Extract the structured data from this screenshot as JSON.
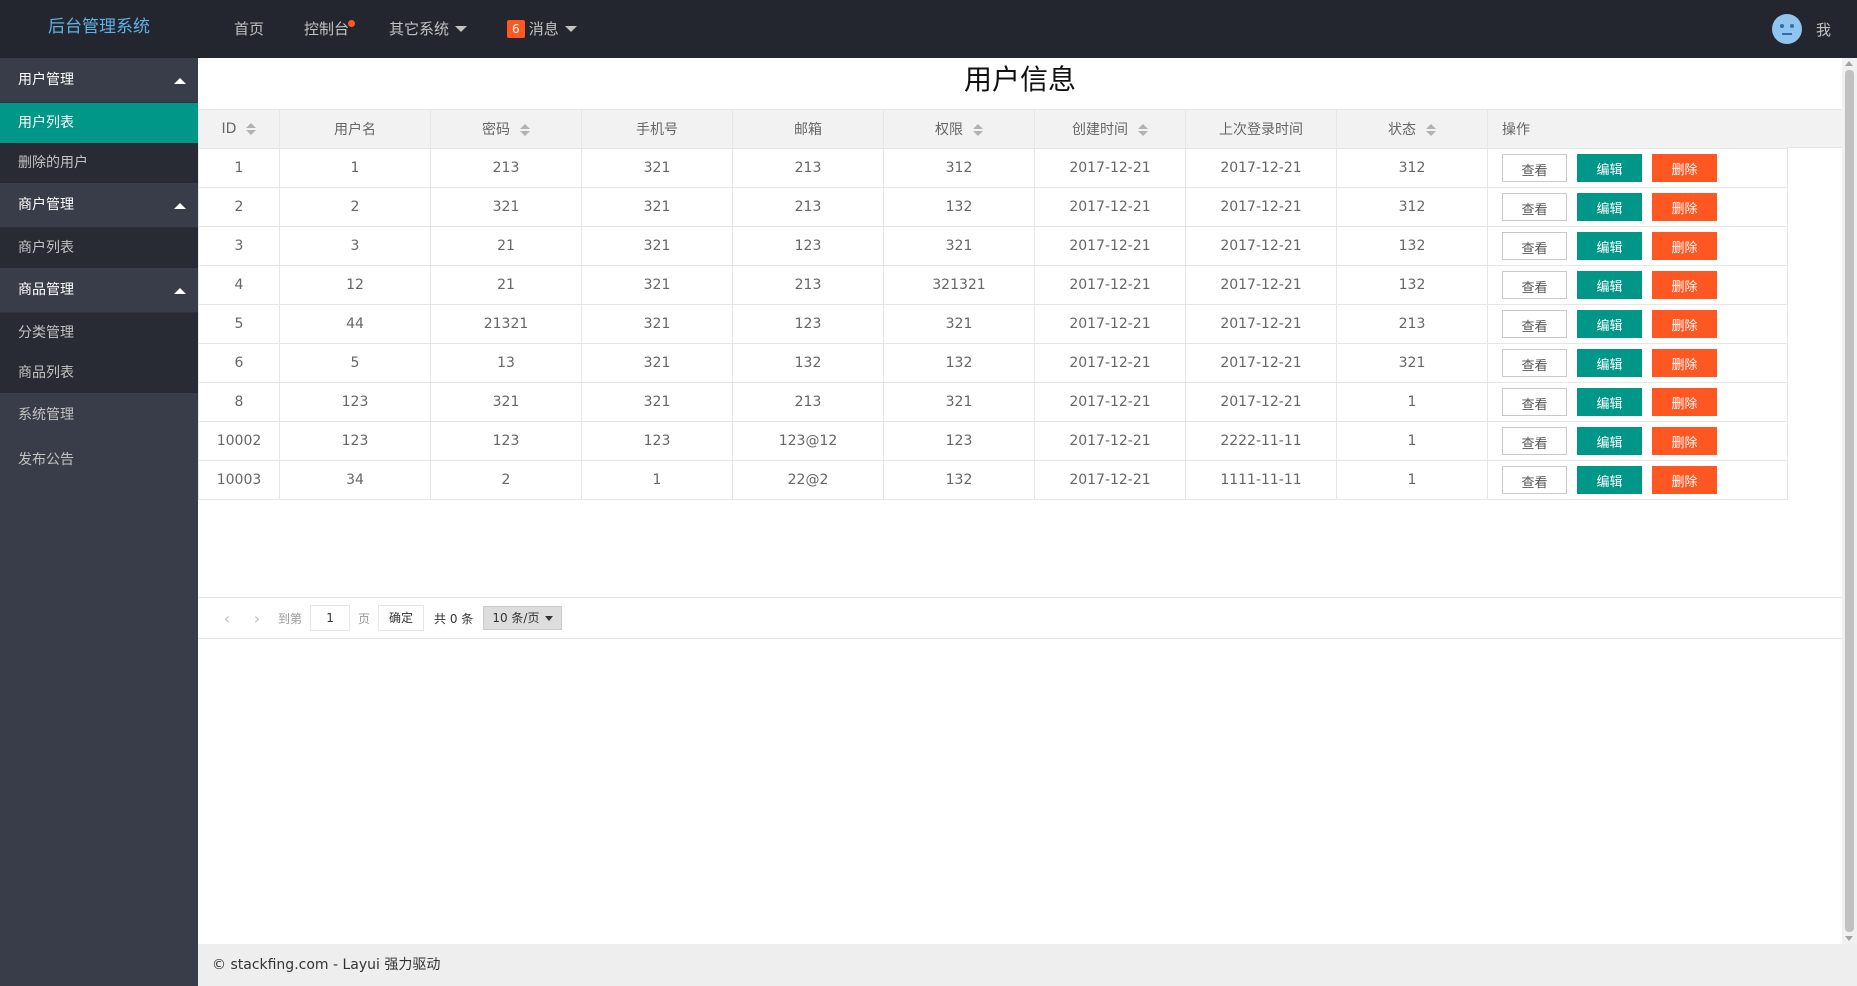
{
  "header": {
    "logo": "后台管理系统",
    "nav": [
      {
        "label": "首页"
      },
      {
        "label": "控制台"
      },
      {
        "label": "其它系统"
      },
      {
        "label": "消息",
        "badge": "6"
      }
    ],
    "user_label": "我"
  },
  "sidebar": {
    "groups": [
      {
        "label": "用户管理",
        "children": [
          "用户列表",
          "删除的用户"
        ]
      },
      {
        "label": "商户管理",
        "children": [
          "商户列表"
        ]
      },
      {
        "label": "商品管理",
        "children": [
          "分类管理",
          "商品列表"
        ]
      }
    ],
    "plain": [
      "系统管理",
      "发布公告"
    ]
  },
  "page": {
    "title": "用户信息"
  },
  "table": {
    "columns": [
      "ID",
      "用户名",
      "密码",
      "手机号",
      "邮箱",
      "权限",
      "创建时间",
      "上次登录时间",
      "状态",
      "操作"
    ],
    "rows": [
      [
        "1",
        "1",
        "213",
        "321",
        "213",
        "312",
        "2017-12-21",
        "2017-12-21",
        "312"
      ],
      [
        "2",
        "2",
        "321",
        "321",
        "213",
        "132",
        "2017-12-21",
        "2017-12-21",
        "312"
      ],
      [
        "3",
        "3",
        "21",
        "321",
        "123",
        "321",
        "2017-12-21",
        "2017-12-21",
        "132"
      ],
      [
        "4",
        "12",
        "21",
        "321",
        "213",
        "321321",
        "2017-12-21",
        "2017-12-21",
        "132"
      ],
      [
        "5",
        "44",
        "21321",
        "321",
        "123",
        "321",
        "2017-12-21",
        "2017-12-21",
        "213"
      ],
      [
        "6",
        "5",
        "13",
        "321",
        "132",
        "132",
        "2017-12-21",
        "2017-12-21",
        "321"
      ],
      [
        "8",
        "123",
        "321",
        "321",
        "213",
        "321",
        "2017-12-21",
        "2017-12-21",
        "1"
      ],
      [
        "10002",
        "123",
        "123",
        "123",
        "123@12",
        "123",
        "2017-12-21",
        "2222-11-11",
        "1"
      ],
      [
        "10003",
        "34",
        "2",
        "1",
        "22@2",
        "132",
        "2017-12-21",
        "1111-11-11",
        "1"
      ]
    ],
    "actions": {
      "view": "查看",
      "edit": "编辑",
      "delete": "删除"
    }
  },
  "pager": {
    "goto_label": "到第",
    "page_value": "1",
    "page_unit": "页",
    "confirm": "确定",
    "total": "共 0 条",
    "per_page": "10 条/页"
  },
  "footer": {
    "text": "© stackfing.com - Layui 强力驱动"
  },
  "colors": {
    "header_bg": "#23262e",
    "sidebar_bg": "#393d49",
    "accent": "#009688",
    "danger": "#ff5722"
  }
}
